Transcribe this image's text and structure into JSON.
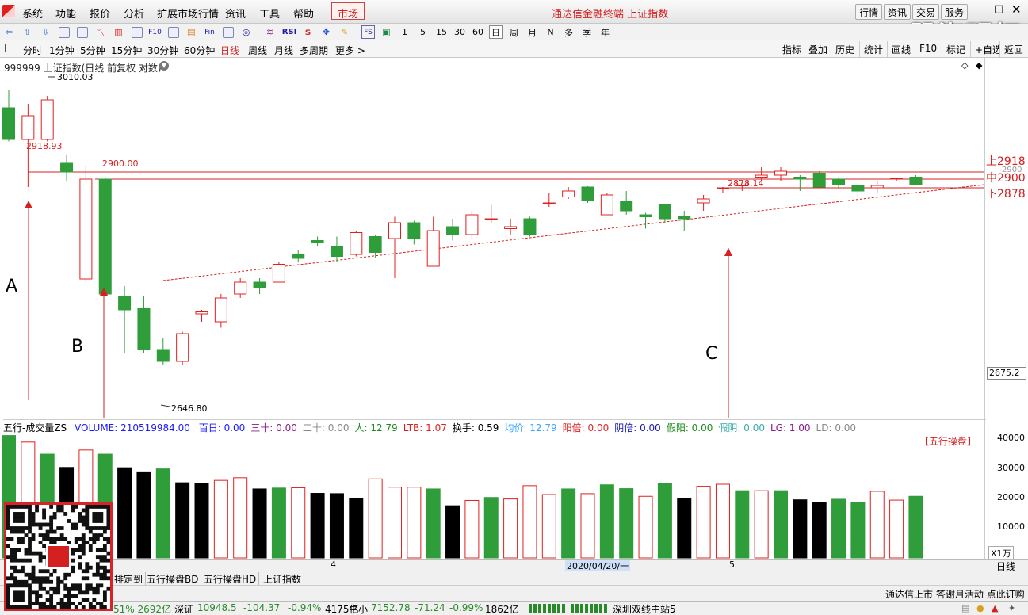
{
  "app": {
    "market_label": "市场",
    "title": "通达信金融终端 上证指数",
    "watermark": "股海明灯"
  },
  "menu": [
    "系统",
    "功能",
    "报价",
    "分析",
    "扩展市场行情",
    "资讯",
    "工具",
    "帮助"
  ],
  "window_buttons": [
    "行情",
    "资讯",
    "交易",
    "服务"
  ],
  "toolbar": {
    "fs_label": "FS",
    "rsi_label": "RSI",
    "periods": [
      "1",
      "5",
      "15",
      "30",
      "60"
    ],
    "period_words": [
      "日",
      "周",
      "月",
      "N",
      "多",
      "季",
      "年"
    ]
  },
  "periodbar": {
    "items": [
      "分时",
      "1分钟",
      "5分钟",
      "15分钟",
      "30分钟",
      "60分钟",
      "日线",
      "周线",
      "月线",
      "多周期",
      "更多 >"
    ],
    "active": "日线",
    "right_buttons": [
      "指标",
      "叠加",
      "历史",
      "统计",
      "画线",
      "F10",
      "+自选",
      "返回"
    ]
  },
  "chart": {
    "header": "999999 上证指数(日线 前复权 对数)",
    "price_labels": {
      "high": "3010.03",
      "level1": "2918.93",
      "level2": "2900.00",
      "level3": "2878.14",
      "low": "2646.80",
      "right_axis": "2675.2",
      "right_axis_top": "2900"
    },
    "level_labels": {
      "upper": "上2918",
      "middle": "中2900",
      "lower": "下2878"
    },
    "point_labels": [
      "A",
      "B",
      "C"
    ],
    "colors": {
      "up": "#e02020",
      "down": "#2f9d3a",
      "line": "#d42020"
    }
  },
  "chart_data": {
    "type": "candlestick",
    "ohlc": [
      [
        3080,
        3125,
        2995,
        3000
      ],
      [
        3000,
        3090,
        2880,
        3060
      ],
      [
        3000,
        3110,
        2995,
        3100
      ],
      [
        2940,
        2960,
        2895,
        2918
      ],
      [
        2648,
        2932,
        2640,
        2900
      ],
      [
        2900,
        2905,
        2605,
        2610
      ],
      [
        2605,
        2630,
        2460,
        2570
      ],
      [
        2575,
        2605,
        2460,
        2470
      ],
      [
        2470,
        2500,
        2430,
        2440
      ],
      [
        2440,
        2515,
        2430,
        2510
      ],
      [
        2560,
        2570,
        2540,
        2565
      ],
      [
        2540,
        2610,
        2525,
        2600
      ],
      [
        2610,
        2650,
        2600,
        2640
      ],
      [
        2640,
        2650,
        2610,
        2625
      ],
      [
        2640,
        2690,
        2640,
        2685
      ],
      [
        2710,
        2720,
        2690,
        2700
      ],
      [
        2745,
        2755,
        2730,
        2740
      ],
      [
        2730,
        2755,
        2690,
        2705
      ],
      [
        2710,
        2770,
        2705,
        2765
      ],
      [
        2755,
        2760,
        2700,
        2715
      ],
      [
        2750,
        2805,
        2650,
        2790
      ],
      [
        2790,
        2795,
        2735,
        2750
      ],
      [
        2680,
        2805,
        2680,
        2770
      ],
      [
        2780,
        2800,
        2745,
        2760
      ],
      [
        2760,
        2820,
        2750,
        2810
      ],
      [
        2800,
        2835,
        2790,
        2800
      ],
      [
        2775,
        2800,
        2760,
        2780
      ],
      [
        2800,
        2805,
        2755,
        2760
      ],
      [
        2840,
        2865,
        2830,
        2840
      ],
      [
        2855,
        2880,
        2850,
        2870
      ],
      [
        2880,
        2882,
        2840,
        2845
      ],
      [
        2810,
        2865,
        2810,
        2860
      ],
      [
        2845,
        2870,
        2810,
        2820
      ],
      [
        2810,
        2815,
        2775,
        2805
      ],
      [
        2835,
        2835,
        2790,
        2800
      ],
      [
        2805,
        2820,
        2770,
        2800
      ],
      [
        2840,
        2860,
        2820,
        2850
      ],
      [
        2878,
        2880,
        2865,
        2878
      ],
      [
        2883,
        2890,
        2870,
        2895
      ],
      [
        2905,
        2930,
        2895,
        2910
      ],
      [
        2910,
        2930,
        2895,
        2920
      ],
      [
        2905,
        2910,
        2870,
        2900
      ],
      [
        2915,
        2920,
        2885,
        2880
      ],
      [
        2900,
        2905,
        2875,
        2885
      ],
      [
        2885,
        2890,
        2855,
        2870
      ],
      [
        2878,
        2895,
        2865,
        2884
      ],
      [
        2900,
        2903,
        2895,
        2902
      ],
      [
        2905,
        2910,
        2885,
        2887
      ]
    ],
    "volume": [
      41500,
      39300,
      35200,
      30700,
      36600,
      35200,
      30600,
      29200,
      30200,
      25500,
      25300,
      26300,
      27200,
      23400,
      23700,
      23800,
      21900,
      21800,
      20300,
      26800,
      24000,
      24000,
      23400,
      17700,
      19500,
      20500,
      20000,
      24500,
      21500,
      23400,
      21800,
      24800,
      23500,
      20900,
      25400,
      20300,
      24300,
      25000,
      22800,
      22800,
      22800,
      19700,
      18700,
      19900,
      18900,
      22600,
      19600,
      20900
    ],
    "volume_colors": [
      "g",
      "r",
      "g",
      "b",
      "r",
      "g",
      "b",
      "b",
      "g",
      "b",
      "b",
      "r",
      "r",
      "b",
      "g",
      "r",
      "b",
      "b",
      "b",
      "r",
      "r",
      "r",
      "g",
      "b",
      "r",
      "g",
      "r",
      "r",
      "r",
      "g",
      "r",
      "g",
      "g",
      "r",
      "g",
      "b",
      "r",
      "r",
      "g",
      "r",
      "g",
      "b",
      "b",
      "g",
      "g",
      "r",
      "r",
      "g"
    ],
    "volume_axis": [
      "40000",
      "30000",
      "20000",
      "10000"
    ],
    "volume_unit": "X1万",
    "x_ticks": [
      "4",
      "2020/04/20/一",
      "5"
    ]
  },
  "indicators": {
    "name": "五行-成交量ZS",
    "volume": "VOLUME: 210519984.00",
    "items": [
      [
        "百日: 0.00",
        "#1a1aff"
      ],
      [
        "三十: 0.00",
        "#8a1a8a"
      ],
      [
        "二十: 0.00",
        "#888"
      ],
      [
        "人: 12.79",
        "#1a8a1a"
      ],
      [
        "LTB: 1.07",
        "#e02020"
      ],
      [
        "换手: 0.59",
        "#000"
      ],
      [
        "均价: 12.79",
        "#3aa6ff"
      ],
      [
        "阳倍: 0.00",
        "#e02020"
      ],
      [
        "阴倍: 0.00",
        "#1a1aaa"
      ],
      [
        "假阳: 0.00",
        "#1a8a1a"
      ],
      [
        "假阴: 0.00",
        "#3aaaaa"
      ],
      [
        "LG: 1.00",
        "#8a1a8a"
      ],
      [
        "LD: 0.00",
        "#888"
      ]
    ],
    "badge": "【五行操盘】"
  },
  "axisbar": {
    "right_label": "日线"
  },
  "tabs": [
    "排定到",
    "五行操盘BD",
    "五行操盘HD",
    "上证指数"
  ],
  "status": {
    "scroll": "通达信上市 答谢月活动 点此订购"
  },
  "indexbar": {
    "sh_tail": "51% 2692亿",
    "sz_name": "深证",
    "sz_val": "10948.5",
    "sz_chg": "-104.37",
    "sz_pct": "-0.94%",
    "sz_amt": "4175亿",
    "zx_name": "中小",
    "zx_val": "7152.78",
    "zx_chg": "-71.24",
    "zx_pct": "-0.99%",
    "zx_amt": "1862亿",
    "server": "深圳双线主站5"
  }
}
